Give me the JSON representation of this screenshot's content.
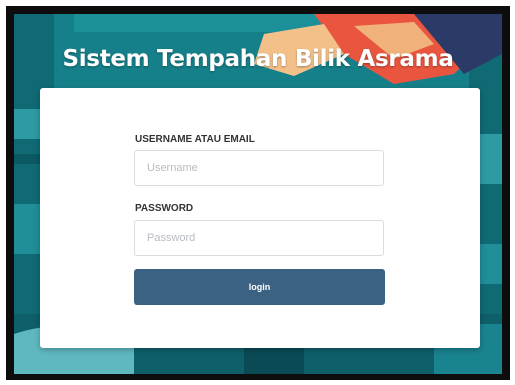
{
  "app": {
    "title": "Sistem Tempahan Bilik Asrama"
  },
  "login": {
    "username_label": "USERNAME ATAU EMAIL",
    "username_placeholder": "Username",
    "username_value": "",
    "password_label": "PASSWORD",
    "password_placeholder": "Password",
    "password_value": "",
    "submit_label": "login"
  },
  "colors": {
    "button": "#3b6183",
    "background_teal": "#16808a",
    "card": "#ffffff"
  }
}
